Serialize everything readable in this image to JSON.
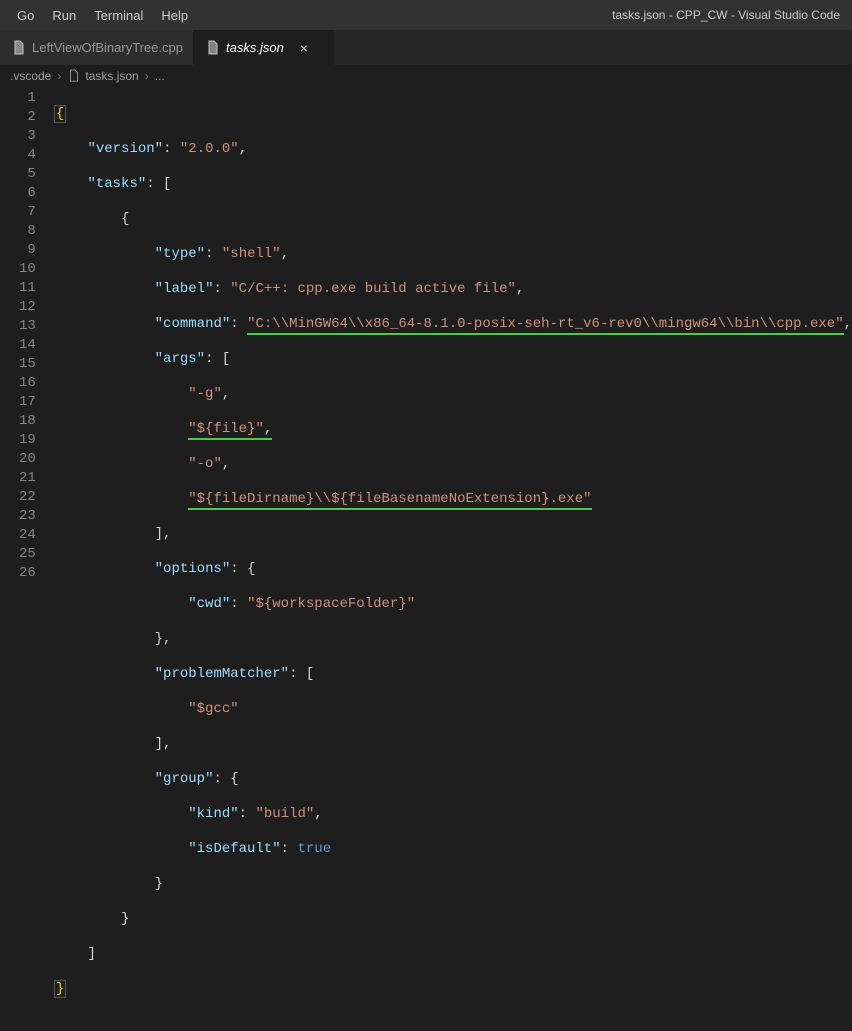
{
  "window_title": "tasks.json - CPP_CW - Visual Studio Code",
  "menu": {
    "go": "Go",
    "run": "Run",
    "terminal": "Terminal",
    "help": "Help"
  },
  "tabs": {
    "t0": {
      "label": "LeftViewOfBinaryTree.cpp"
    },
    "t1": {
      "label": "tasks.json",
      "close": "×"
    }
  },
  "breadcrumbs": {
    "b0": ".vscode",
    "b1": "tasks.json",
    "b2": "..."
  },
  "code": {
    "version_key": "\"version\"",
    "version_val": "\"2.0.0\"",
    "tasks_key": "\"tasks\"",
    "type_key": "\"type\"",
    "type_val": "\"shell\"",
    "label_key": "\"label\"",
    "label_val": "\"C/C++: cpp.exe build active file\"",
    "command_key": "\"command\"",
    "command_val": "\"C:\\\\MinGW64\\\\x86_64-8.1.0-posix-seh-rt_v6-rev0\\\\mingw64\\\\bin\\\\cpp.exe\"",
    "args_key": "\"args\"",
    "arg_g": "\"-g\"",
    "arg_file": "\"${file}\"",
    "arg_o": "\"-o\"",
    "arg_out": "\"${fileDirname}\\\\${fileBasenameNoExtension}.exe\"",
    "options_key": "\"options\"",
    "cwd_key": "\"cwd\"",
    "cwd_val": "\"${workspaceFolder}\"",
    "pm_key": "\"problemMatcher\"",
    "pm_val": "\"$gcc\"",
    "group_key": "\"group\"",
    "kind_key": "\"kind\"",
    "kind_val": "\"build\"",
    "isdef_key": "\"isDefault\"",
    "isdef_val": "true"
  },
  "lines": [
    "1",
    "2",
    "3",
    "4",
    "5",
    "6",
    "7",
    "8",
    "9",
    "10",
    "11",
    "12",
    "13",
    "14",
    "15",
    "16",
    "17",
    "18",
    "19",
    "20",
    "21",
    "22",
    "23",
    "24",
    "25",
    "26"
  ]
}
